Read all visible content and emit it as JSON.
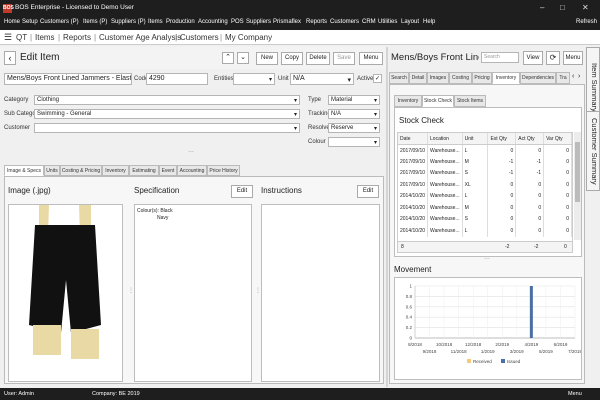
{
  "app": {
    "title": "BOS Enterprise - Licensed to Demo User",
    "logo": "BOS"
  },
  "menu": [
    "Home",
    "Setup",
    "Customers (P)",
    "Items (P)",
    "Suppliers (P)",
    "Items",
    "Production",
    "Accounting",
    "POS",
    "Suppliers",
    "Prismaflex",
    "Reports",
    "Customers",
    "CRM",
    "Utilities",
    "Layout",
    "Help"
  ],
  "refresh_label": "Refresh",
  "breadcrumb": {
    "icon": "menu-icon",
    "items": [
      "QT",
      "Items",
      "Reports",
      "Customer Age Analysis",
      "Customers",
      "My Company"
    ]
  },
  "edit_item": {
    "title": "Edit Item",
    "buttons": {
      "new": "New",
      "copy": "Copy",
      "delete": "Delete",
      "save": "Save",
      "menu": "Menu"
    },
    "description": "Mens/Boys Front Lined Jammers - Elastic",
    "code_label": "Code",
    "code": "4290",
    "entities_label": "Entities",
    "unit_label": "Unit",
    "unit": "N/A",
    "active_label": "Active",
    "category_label": "Category",
    "category": "Clothing",
    "subcategory_label": "Sub Category",
    "subcategory": "Swimming - General",
    "customer_label": "Customer",
    "customer": "",
    "type_label": "Type",
    "type": "Material",
    "tracking_label": "Tracking",
    "tracking": "N/A",
    "resolve_label": "Resolve",
    "resolve": "Reserve",
    "colour_label": "Colour",
    "colour": "",
    "tabs": [
      "Image & Specs",
      "Units",
      "Costing & Pricing",
      "Inventory",
      "Estimating",
      "Event",
      "Accounting",
      "Price History"
    ],
    "image_title": "Image (.jpg)",
    "spec_title": "Specification",
    "spec_edit": "Edit",
    "spec_lines": [
      "Colour(s): Black",
      "Navy"
    ],
    "instructions_title": "Instructions",
    "instructions_edit": "Edit"
  },
  "right": {
    "title": "Mens/Boys Front Lined Jammers",
    "search_placeholder": "Search",
    "view_label": "View",
    "menu_label": "Menu",
    "tabs": [
      "Search",
      "Detail",
      "Images",
      "Costing",
      "Pricing",
      "Inventory",
      "Dependencies",
      "Tra"
    ],
    "subtabs": [
      "Inventory",
      "Stock Check",
      "Stock Items"
    ],
    "stock_title": "Stock Check",
    "columns": [
      "Date",
      "Location",
      "Unit",
      "Ext Qty",
      "Act Qty",
      "Var Qty"
    ],
    "rows": [
      [
        "2017/09/10",
        "Warehouse...",
        "L",
        "0",
        "0",
        "0"
      ],
      [
        "2017/09/10",
        "Warehouse...",
        "M",
        "-1",
        "-1",
        "0"
      ],
      [
        "2017/09/10",
        "Warehouse...",
        "S",
        "-1",
        "-1",
        "0"
      ],
      [
        "2017/09/10",
        "Warehouse...",
        "XL",
        "0",
        "0",
        "0"
      ],
      [
        "2014/10/20",
        "Warehouse...",
        "L",
        "0",
        "0",
        "0"
      ],
      [
        "2014/10/20",
        "Warehouse...",
        "M",
        "0",
        "0",
        "0"
      ],
      [
        "2014/10/20",
        "Warehouse...",
        "S",
        "0",
        "0",
        "0"
      ],
      [
        "2014/10/20",
        "Warehouse...",
        "L",
        "0",
        "0",
        "0"
      ]
    ],
    "footer": [
      "8",
      "",
      "",
      "-2",
      "-2",
      "0"
    ],
    "movement_title": "Movement"
  },
  "chart_data": {
    "type": "bar",
    "x_ticks_top": [
      "8/2018",
      "10/2018",
      "12/2018",
      "2/2019",
      "4/2019",
      "6/2019"
    ],
    "x_ticks_bottom": [
      "9/2018",
      "11/2018",
      "1/2019",
      "3/2019",
      "5/2019",
      "7/2019"
    ],
    "y_ticks": [
      "0",
      "0.2",
      "0.4",
      "0.6",
      "0.8",
      "1"
    ],
    "ylim": [
      0,
      1
    ],
    "series": [
      {
        "name": "Received",
        "color": "#f5c97a",
        "points": []
      },
      {
        "name": "Issued",
        "color": "#4a6fa5",
        "points": [
          {
            "x": "4/2019",
            "value": 1
          }
        ]
      }
    ]
  },
  "side_tabs": [
    "Item Summary",
    "Customer Summary"
  ],
  "status": {
    "user": "User: Admin",
    "company": "Company: BE 2019",
    "menu": "Menu"
  }
}
